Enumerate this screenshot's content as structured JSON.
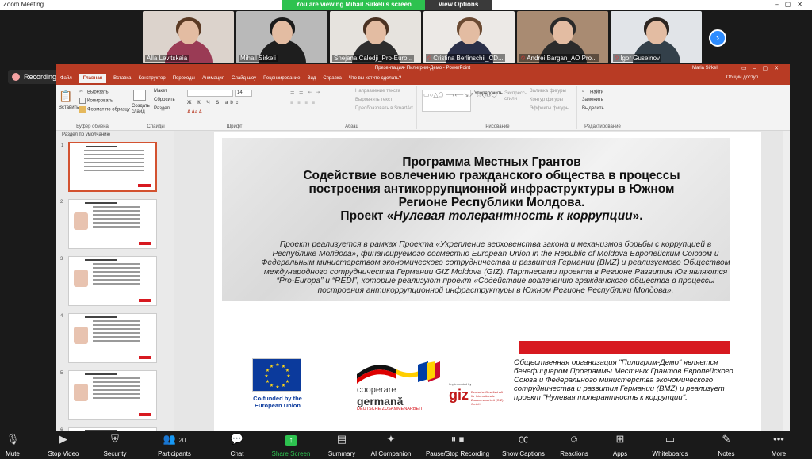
{
  "window": {
    "title": "Zoom Meeting"
  },
  "banner": {
    "viewing": "You are viewing Mihail Sirkeli's screen",
    "options": "View Options"
  },
  "participants": [
    {
      "name": "Alla Levitskaia",
      "bg": "#dcd3cc",
      "shirt": "#9a3b55",
      "hair": "#5b3a24",
      "muted": false
    },
    {
      "name": "Mihail Sirkeli",
      "bg": "#b9b9b9",
      "shirt": "#1e1e1e",
      "hair": "#1b1b1b",
      "muted": false
    },
    {
      "name": "Snejana Caledji_Pro-Euro...",
      "bg": "#e6e3de",
      "shirt": "#2d2d2d",
      "hair": "#4a3222",
      "muted": false
    },
    {
      "name": "Cristina Berlinschii_CD...",
      "bg": "#ece9e6",
      "shirt": "#2a2f48",
      "hair": "#6b4a32",
      "muted": true
    },
    {
      "name": "Andrei Bargan_AO Pro...",
      "bg": "#a98b72",
      "shirt": "#2b2b2b",
      "hair": "#2a2a2a",
      "muted": true
    },
    {
      "name": "Igor Guseinov",
      "bg": "#e1e4e8",
      "shirt": "#33404a",
      "hair": "#2c2520",
      "muted": true
    }
  ],
  "recording": {
    "label": "Recording..."
  },
  "ppt": {
    "title": "Презентация- Пилигрим-Демо  -  PowerPoint",
    "user": "Maria Sirkeli",
    "tabs": [
      "Файл",
      "Главная",
      "Вставка",
      "Конструктор",
      "Переходы",
      "Анимация",
      "Слайд-шоу",
      "Рецензирование",
      "Вид",
      "Справка",
      "Что вы хотите сделать?"
    ],
    "share": "Общий доступ",
    "ribbon": {
      "paste": "Вставить",
      "cut": "Вырезать",
      "copy": "Копировать",
      "format": "Формат по образцу",
      "clipboard": "Буфер обмена",
      "new_slide": "Создать слайд",
      "layout": "Макет",
      "reset": "Сбросить",
      "section": "Раздел",
      "slides": "Слайды",
      "font_size": "14",
      "font": "Шрифт",
      "text_dir": "Направление текста",
      "align_text": "Выровнять текст",
      "smartart": "Преобразовать в SmartArt",
      "paragraph": "Абзац",
      "arrange": "Упорядочить",
      "quick_styles": "Экспресс-стили",
      "fill": "Заливка фигуры",
      "outline": "Контур фигуры",
      "effects": "Эффекты фигуры",
      "drawing": "Рисование",
      "find": "Найти",
      "replace": "Заменить",
      "select": "Выделить",
      "editing": "Редактирование"
    },
    "section_header": "Раздел по умолчанию",
    "thumb_numbers": [
      "1",
      "2",
      "3",
      "4",
      "5",
      "6"
    ]
  },
  "slide": {
    "title_lines": [
      "Программа Местных Грантов",
      "Содействие вовлечению гражданского общества в процессы",
      "построения антикоррупционной инфраструктуры в Южном",
      "Регионе Республики Молдова."
    ],
    "title_prefix": "Проект «",
    "title_italic": "Нулевая толерантность к коррупции",
    "title_suffix": "».",
    "body": "Проект реализуется в  рамках Проекта «Укрепление верховенства закона и механизмов борьбы с коррупцией в Республике Молдова», финансируемого совместно European Union in the Republic of Moldova Европейским Союзом и Федеральным министерством экономического сотрудничества и развития Германии (BMZ) и реализуемого Обществом международного сотрудничества Германии GIZ Moldova (GIZ). Партнерами проекта в Регионе Развития Юг являются “Pro-Europa” и “REDI”, которые реализуют проект «Содействие вовлечению гражданского общества в процессы построения антикоррупционной инфраструктуры в Южном Регионе Республики Молдова».",
    "eu_caption": "Co-funded by the European Union",
    "coop_1": "cooperare",
    "coop_2": "germană",
    "coop_3": "DEUTSCHE ZUSAMMENARBEIT",
    "giz_impl": "Implemented by",
    "giz": "giz",
    "giz_text": "Deutsche Gesellschaft für Internationale Zusammenarbeit (GIZ) GmbH",
    "note": "Общественная организация \"Пилигрим-Демо\" является бенефициаром Программы Местных Грантов Европейского Союза и Федерального министерства экономического сотрудничества и развития Германии (BMZ) и реализует проект \"Нулевая толерантность к коррупции\"."
  },
  "toolbar": {
    "mute": "Mute",
    "stop_video": "Stop Video",
    "security": "Security",
    "participants": "Participants",
    "participants_count": "20",
    "chat": "Chat",
    "share_screen": "Share Screen",
    "summary": "Summary",
    "ai": "AI Companion",
    "recording": "Pause/Stop Recording",
    "captions": "Show Captions",
    "reactions": "Reactions",
    "apps": "Apps",
    "whiteboards": "Whiteboards",
    "notes": "Notes",
    "more": "More"
  }
}
